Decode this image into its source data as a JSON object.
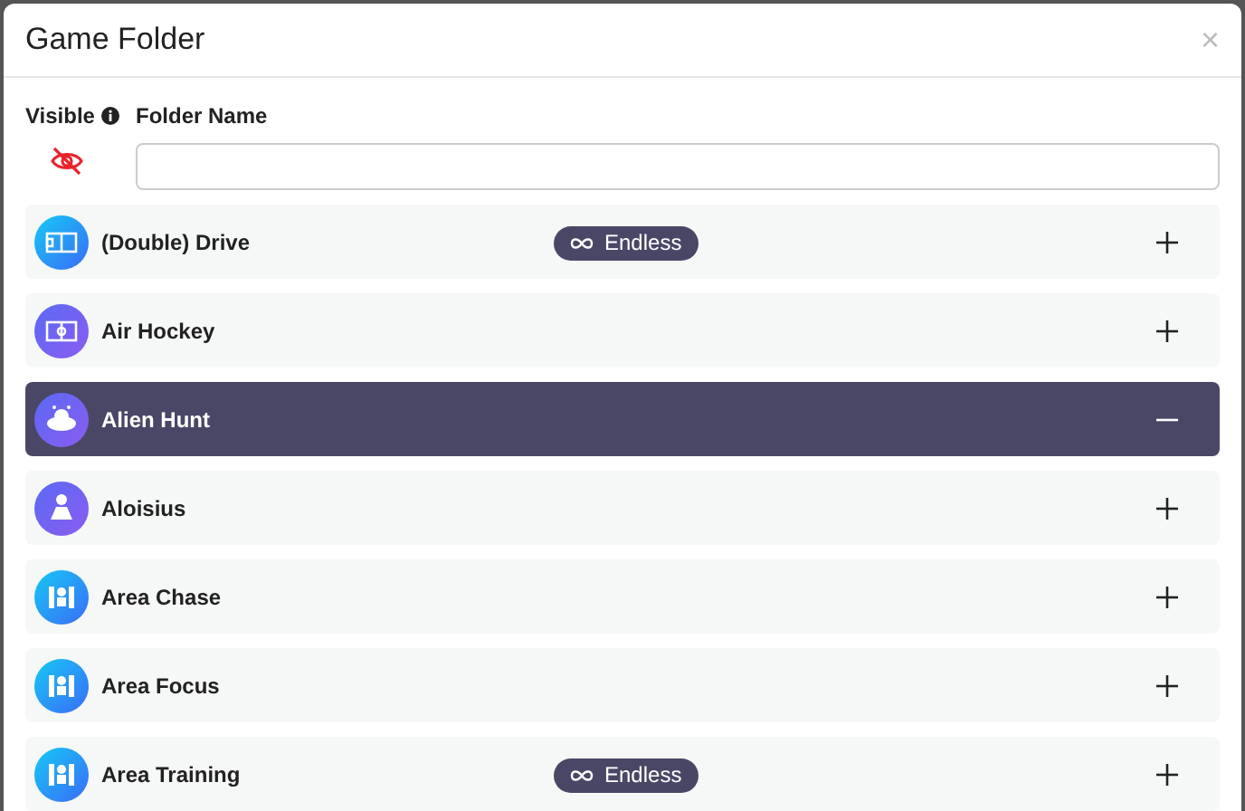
{
  "dialog": {
    "title": "Game Folder",
    "close": "×"
  },
  "form": {
    "visible_label": "Visible",
    "visible": false,
    "name_label": "Folder Name"
  },
  "games": [
    {
      "name": "(Double) Drive",
      "kind": "field",
      "badge": "Endless",
      "selected": false
    },
    {
      "name": "Air Hockey",
      "kind": "rink",
      "selected": false
    },
    {
      "name": "Alien Hunt",
      "kind": "alien",
      "selected": true
    },
    {
      "name": "Aloisius",
      "kind": "figure",
      "selected": false
    },
    {
      "name": "Area Chase",
      "kind": "area",
      "selected": false
    },
    {
      "name": "Area Focus",
      "kind": "area",
      "selected": false
    },
    {
      "name": "Area Training",
      "kind": "area",
      "badge": "Endless",
      "selected": false
    }
  ]
}
